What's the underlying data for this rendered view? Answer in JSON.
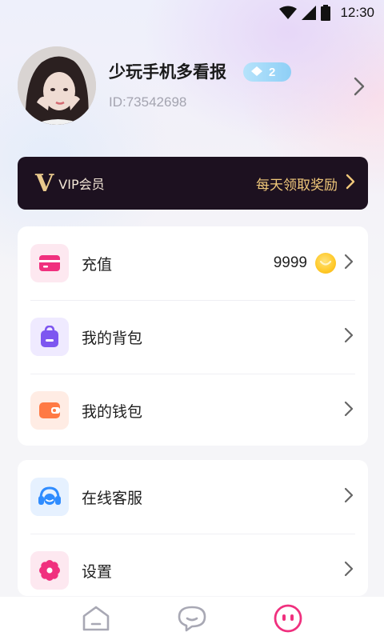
{
  "status_bar": {
    "time": "12:30"
  },
  "profile": {
    "name": "少玩手机多看报",
    "level": "2",
    "user_id": "ID:73542698"
  },
  "vip": {
    "logo": "V",
    "label": "VIP会员",
    "reward": "每天领取奖励"
  },
  "menu_primary": [
    {
      "label": "充值",
      "value": "9999",
      "icon": "card-icon"
    },
    {
      "label": "我的背包",
      "icon": "backpack-icon"
    },
    {
      "label": "我的钱包",
      "icon": "wallet-icon"
    }
  ],
  "menu_secondary": [
    {
      "label": "在线客服",
      "icon": "headset-icon"
    },
    {
      "label": "设置",
      "icon": "settings-icon"
    }
  ],
  "tabs": [
    {
      "name": "home",
      "active": false
    },
    {
      "name": "messages",
      "active": false
    },
    {
      "name": "me",
      "active": true
    }
  ],
  "colors": {
    "vip_bg": "#1d1120",
    "vip_gold": "#f0c87a",
    "accent_pink": "#f0307e",
    "accent_purple": "#7d56f0",
    "accent_orange": "#ff7a45",
    "accent_blue": "#2f8cff",
    "level_badge": "#8ecff6"
  }
}
